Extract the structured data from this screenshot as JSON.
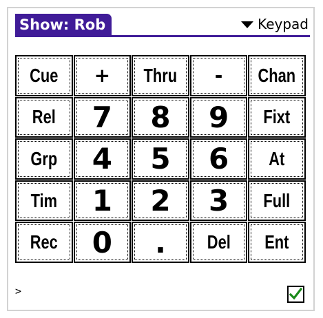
{
  "header": {
    "show_title": "Show: Rob",
    "view_label": "Keypad"
  },
  "keypad": {
    "keys": [
      "Cue",
      "+",
      "Thru",
      "-",
      "Chan",
      "Rel",
      "7",
      "8",
      "9",
      "Fixt",
      "Grp",
      "4",
      "5",
      "6",
      "At",
      "Tim",
      "1",
      "2",
      "3",
      "Full",
      "Rec",
      "0",
      ".",
      "Del",
      "Ent"
    ]
  },
  "command_line": {
    "prompt": ">"
  },
  "checkbox": {
    "checked": true,
    "check_color": "#1a8a1a"
  },
  "colors": {
    "title_tab": "#401c98"
  }
}
